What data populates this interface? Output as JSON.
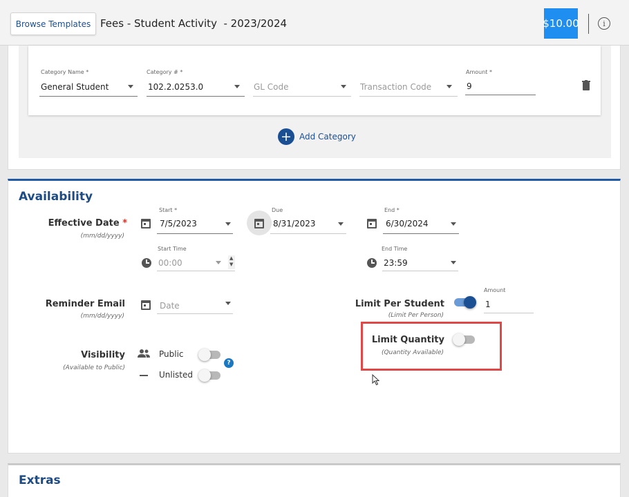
{
  "header": {
    "browse_templates_label": "Browse Templates",
    "title": "Fees - Student Activity  - 2023/2024",
    "price": "$10.00",
    "info_icon": "info-icon"
  },
  "category": {
    "name_label": "Category Name *",
    "name_value": "General Student",
    "number_label": "Category # *",
    "number_value": "102.2.0253.0",
    "gl_placeholder": "GL Code",
    "transaction_placeholder": "Transaction Code",
    "amount_label": "Amount *",
    "amount_value": "9",
    "add_label": "Add Category"
  },
  "availability": {
    "title": "Availability",
    "effective_date": {
      "label": "Effective Date",
      "required_mark": "*",
      "sub": "(mm/dd/yyyy)",
      "start_label": "Start *",
      "start_value": "7/5/2023",
      "due_label": "Due",
      "due_value": "8/31/2023",
      "end_label": "End *",
      "end_value": "6/30/2024",
      "start_time_label": "Start Time",
      "start_time_value": "00:00",
      "end_time_label": "End Time",
      "end_time_value": "23:59"
    },
    "reminder": {
      "label": "Reminder Email",
      "sub": "(mm/dd/yyyy)",
      "placeholder": "Date"
    },
    "limit_per_student": {
      "label": "Limit Per Student",
      "sub": "(Limit Per Person)",
      "enabled": true,
      "amount_label": "Amount",
      "amount_value": "1"
    },
    "limit_quantity": {
      "label": "Limit Quantity",
      "sub": "(Quantity Available)",
      "enabled": false
    },
    "visibility": {
      "label": "Visibility",
      "sub": "(Available to Public)",
      "public_label": "Public",
      "public_enabled": false,
      "unlisted_label": "Unlisted",
      "unlisted_enabled": false,
      "help_glyph": "?"
    }
  },
  "extras": {
    "title": "Extras"
  },
  "colors": {
    "accent": "#1a4f93",
    "price_badge": "#1f8ef1",
    "highlight": "#e04848",
    "required": "#d4342a"
  }
}
